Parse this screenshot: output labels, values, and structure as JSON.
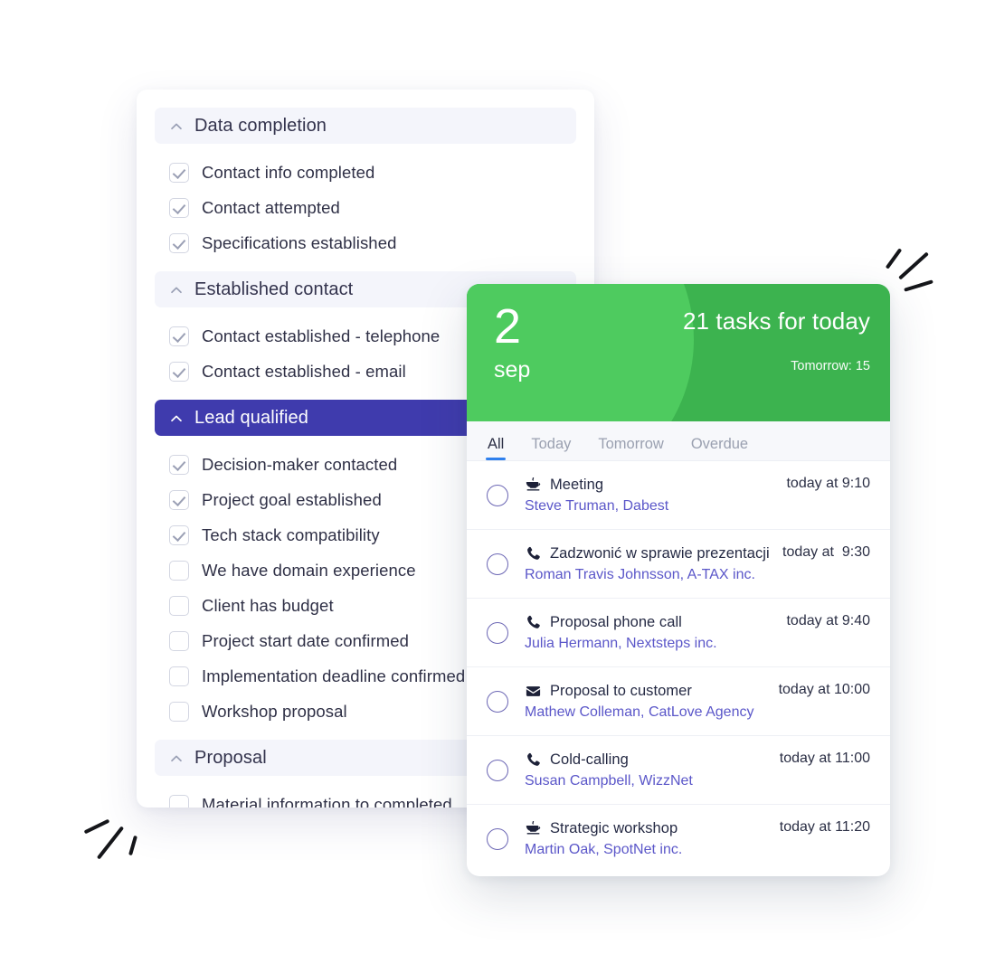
{
  "checklist": {
    "sections": [
      {
        "title": "Data completion",
        "icon": "chevron-up-icon",
        "active": false,
        "items": [
          {
            "label": "Contact info completed",
            "checked": true
          },
          {
            "label": "Contact attempted",
            "checked": true
          },
          {
            "label": "Specifications established",
            "checked": true
          }
        ]
      },
      {
        "title": "Established contact",
        "icon": "chevron-up-icon",
        "active": false,
        "items": [
          {
            "label": "Contact established - telephone",
            "checked": true
          },
          {
            "label": "Contact established - email",
            "checked": true
          }
        ]
      },
      {
        "title": "Lead qualified",
        "icon": "chevron-up-icon",
        "active": true,
        "items": [
          {
            "label": "Decision-maker contacted",
            "checked": true
          },
          {
            "label": "Project goal established",
            "checked": true
          },
          {
            "label": "Tech stack compatibility",
            "checked": true
          },
          {
            "label": "We have domain experience",
            "checked": false
          },
          {
            "label": "Client has budget",
            "checked": false
          },
          {
            "label": "Project start date confirmed",
            "checked": false
          },
          {
            "label": "Implementation deadline confirmed",
            "checked": false
          },
          {
            "label": "Workshop proposal",
            "checked": false
          }
        ]
      },
      {
        "title": "Proposal",
        "icon": "chevron-up-icon",
        "active": false,
        "items": [
          {
            "label": "Material information to completed",
            "checked": false
          }
        ]
      }
    ]
  },
  "tasks_card": {
    "header": {
      "day": "2",
      "month": "sep",
      "count_label": "21 tasks for today",
      "tomorrow_label": "Tomorrow: 15"
    },
    "tabs": [
      {
        "label": "All",
        "selected": true
      },
      {
        "label": "Today",
        "selected": false
      },
      {
        "label": "Tomorrow",
        "selected": false
      },
      {
        "label": "Overdue",
        "selected": false
      }
    ],
    "rows": [
      {
        "icon": "coffee-cup-icon",
        "title": "Meeting",
        "contact": "Steve Truman, Dabest",
        "time": "today at 9:10"
      },
      {
        "icon": "phone-icon",
        "title": "Zadzwonić w sprawie prezentacji",
        "contact": "Roman Travis Johnsson, A-TAX inc.",
        "time": "today at  9:30"
      },
      {
        "icon": "phone-icon",
        "title": "Proposal phone call",
        "contact": "Julia Hermann, Nextsteps inc.",
        "time": "today at 9:40"
      },
      {
        "icon": "envelope-icon",
        "title": "Proposal to customer",
        "contact": "Mathew Colleman, CatLove Agency",
        "time": "today at 10:00"
      },
      {
        "icon": "phone-icon",
        "title": "Cold-calling",
        "contact": "Susan Campbell, WizzNet",
        "time": "today at 11:00"
      },
      {
        "icon": "coffee-cup-icon",
        "title": "Strategic workshop",
        "contact": "Martin Oak, SpotNet inc.",
        "time": "today at 11:20"
      }
    ]
  },
  "colors": {
    "accent_purple": "#3F3BAD",
    "green_light": "#4ECB5F",
    "green_dark": "#3CB34F",
    "tab_underline": "#2F80ED",
    "contact_link": "#5B57C9",
    "section_bg": "#F4F5FB"
  }
}
